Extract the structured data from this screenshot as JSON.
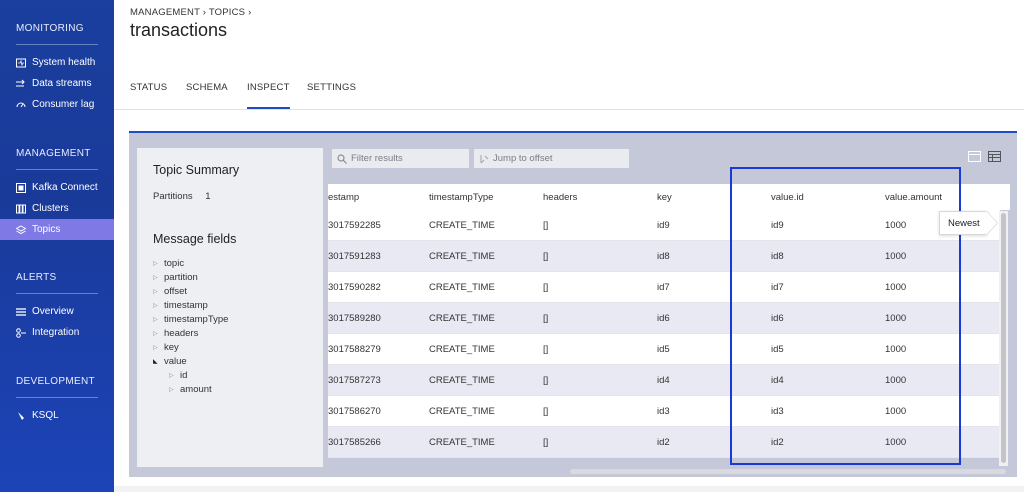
{
  "sidebar": {
    "sections": [
      {
        "title": "MONITORING",
        "items": [
          {
            "label": "System health",
            "icon": "system-health-icon"
          },
          {
            "label": "Data streams",
            "icon": "data-streams-icon"
          },
          {
            "label": "Consumer lag",
            "icon": "consumer-lag-icon"
          }
        ]
      },
      {
        "title": "MANAGEMENT",
        "items": [
          {
            "label": "Kafka Connect",
            "icon": "kafka-connect-icon"
          },
          {
            "label": "Clusters",
            "icon": "clusters-icon"
          },
          {
            "label": "Topics",
            "icon": "topics-icon",
            "active": true
          }
        ]
      },
      {
        "title": "ALERTS",
        "items": [
          {
            "label": "Overview",
            "icon": "overview-icon"
          },
          {
            "label": "Integration",
            "icon": "integration-icon"
          }
        ]
      },
      {
        "title": "DEVELOPMENT",
        "items": [
          {
            "label": "KSQL",
            "icon": "ksql-icon"
          }
        ]
      }
    ],
    "active_color": "#7f79e6"
  },
  "header": {
    "breadcrumb_1": "MANAGEMENT",
    "breadcrumb_2": "TOPICS",
    "title": "transactions"
  },
  "tabs": [
    "STATUS",
    "SCHEMA",
    "INSPECT",
    "SETTINGS"
  ],
  "active_tab": "INSPECT",
  "summary": {
    "title": "Topic Summary",
    "partitions_label": "Partitions",
    "partitions_value": "1",
    "fields_title": "Message fields",
    "fields": [
      "topic",
      "partition",
      "offset",
      "timestamp",
      "timestampType",
      "headers",
      "key",
      "value"
    ],
    "value_children": [
      "id",
      "amount"
    ]
  },
  "toolbar": {
    "filter_placeholder": "Filter results",
    "jump_placeholder": "Jump to offset"
  },
  "table": {
    "columns": [
      "estamp",
      "timestampType",
      "headers",
      "key",
      "value.id",
      "value.amount"
    ],
    "rows": [
      [
        "3017592285",
        "CREATE_TIME",
        "[]",
        "id9",
        "id9",
        "1000"
      ],
      [
        "3017591283",
        "CREATE_TIME",
        "[]",
        "id8",
        "id8",
        "1000"
      ],
      [
        "3017590282",
        "CREATE_TIME",
        "[]",
        "id7",
        "id7",
        "1000"
      ],
      [
        "3017589280",
        "CREATE_TIME",
        "[]",
        "id6",
        "id6",
        "1000"
      ],
      [
        "3017588279",
        "CREATE_TIME",
        "[]",
        "id5",
        "id5",
        "1000"
      ],
      [
        "3017587273",
        "CREATE_TIME",
        "[]",
        "id4",
        "id4",
        "1000"
      ],
      [
        "3017586270",
        "CREATE_TIME",
        "[]",
        "id3",
        "id3",
        "1000"
      ],
      [
        "3017585266",
        "CREATE_TIME",
        "[]",
        "id2",
        "id2",
        "1000"
      ]
    ]
  },
  "tooltip": "Newest",
  "colors": {
    "accent": "#1f4cc4",
    "highlight": "#1a3ad6"
  }
}
